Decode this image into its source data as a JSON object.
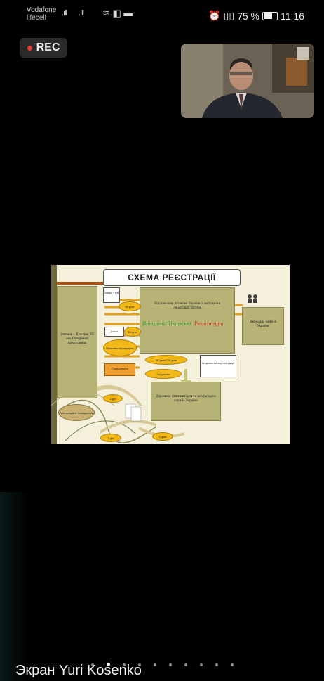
{
  "status_bar": {
    "carrier_line1": "Vodafone",
    "carrier_line2": "lifecell",
    "signal1": ".ıll",
    "signal2": ".ıll",
    "icons": "≋ ◧ ▬",
    "right_icons": "⏰ ▯▯",
    "battery_percent_text": "75 %",
    "battery_level": 0.75,
    "time": "11:16"
  },
  "recording": {
    "label": "REC",
    "dot_color": "#e53935"
  },
  "participant_video": {
    "icon": "person-video-thumbnail"
  },
  "shared_screen": {
    "slide": {
      "title": "СХЕМА РЕЄСТРАЦІЇ",
      "applicant_box": "Заявник – Власник РП або Офіційний представник",
      "national_box": "Національна установа України з лeстування лікарських засобів",
      "state_box": "Державна фітосанітарна та ветеринарна служба України",
      "registry_box": "Державна комісія України",
      "admin_box": "Науково експертна рада",
      "pill_1": "60 днів",
      "pill_2": "Висновок експертизи",
      "pill_3": "60 днів/120 днів",
      "pill_4": "10 днів",
      "pill_5": "2 дні",
      "pill_6": "3 дні",
      "pill_7": "5 днів",
      "pill_8": "Свідоцтво",
      "handwrite_green": "Вакцини/Лікарські",
      "handwrite_red": "Рецептура",
      "small_box_1": "Заява + РД",
      "small_box_2": "Досьє",
      "orange_box_1": "Посвідчення",
      "orange_box_2": "Реєстраційне посвідчення"
    }
  },
  "pager": {
    "count": 10,
    "active_index": 1
  },
  "caption": "Экран Yuri Kosenko"
}
